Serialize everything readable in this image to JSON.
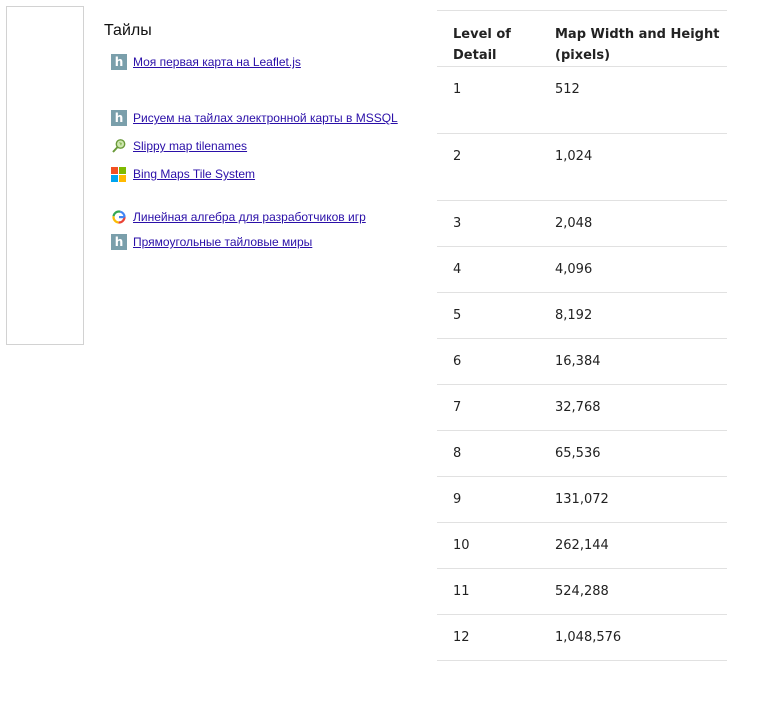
{
  "heading": "Тайлы",
  "links": [
    {
      "text": "Моя первая карта на Leaflet.js",
      "icon": "habr-icon"
    },
    {
      "text": "Рисуем на тайлах электронной карты в MSSQL",
      "icon": "habr-icon"
    },
    {
      "text": "Slippy map tilenames",
      "icon": "osm-wiki-icon"
    },
    {
      "text": "Bing Maps Tile System",
      "icon": "microsoft-icon"
    },
    {
      "text": "Линейная алгебра для разработчиков игр",
      "icon": "google-icon"
    },
    {
      "text": "Прямоугольные тайловые миры",
      "icon": "habr-icon"
    }
  ],
  "colors": {
    "link": "#2a0fa8",
    "habr_icon_bg": "#7a9fab",
    "ms_red": "#f25022",
    "ms_green": "#7fba00",
    "ms_blue": "#00a4ef",
    "ms_yellow": "#ffb900"
  },
  "table": {
    "headers": [
      "Level of Detail",
      "Map Width and Height (pixels)"
    ],
    "rows": [
      [
        "1",
        "512"
      ],
      [
        "2",
        "1,024"
      ],
      [
        "3",
        "2,048"
      ],
      [
        "4",
        "4,096"
      ],
      [
        "5",
        "8,192"
      ],
      [
        "6",
        "16,384"
      ],
      [
        "7",
        "32,768"
      ],
      [
        "8",
        "65,536"
      ],
      [
        "9",
        "131,072"
      ],
      [
        "10",
        "262,144"
      ],
      [
        "11",
        "524,288"
      ],
      [
        "12",
        "1,048,576"
      ]
    ]
  }
}
